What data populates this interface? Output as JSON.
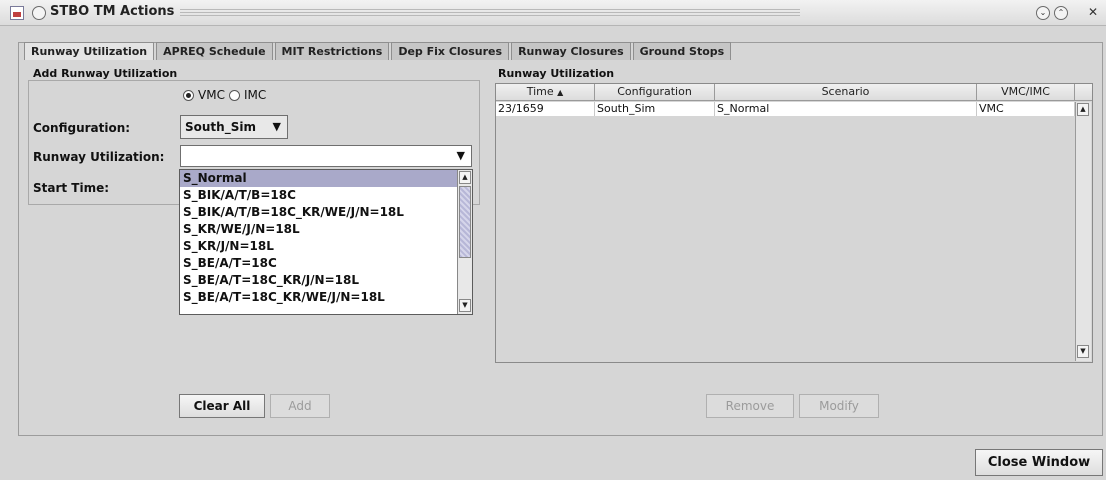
{
  "window": {
    "title": "STBO TM Actions",
    "minimize_icon": "chevron-down-circle-icon",
    "maximize_icon": "chevron-up-circle-icon",
    "close_icon": "close-circle-icon"
  },
  "tabs": [
    {
      "label": "Runway Utilization",
      "active": true
    },
    {
      "label": "APREQ Schedule",
      "active": false
    },
    {
      "label": "MIT Restrictions",
      "active": false
    },
    {
      "label": "Dep Fix Closures",
      "active": false
    },
    {
      "label": "Runway Closures",
      "active": false
    },
    {
      "label": "Ground Stops",
      "active": false
    }
  ],
  "add_panel": {
    "title": "Add Runway Utilization",
    "radio_vmc": "VMC",
    "radio_imc": "IMC",
    "selected_condition": "VMC",
    "configuration_label": "Configuration:",
    "configuration_value": "South_Sim",
    "runway_utilization_label": "Runway Utilization:",
    "runway_utilization_value": "",
    "start_time_label": "Start Time:",
    "dropdown_options": [
      "S_Normal",
      "S_BIK/A/T/B=18C",
      "S_BIK/A/T/B=18C_KR/WE/J/N=18L",
      "S_KR/WE/J/N=18L",
      "S_KR/J/N=18L",
      "S_BE/A/T=18C",
      "S_BE/A/T=18C_KR/J/N=18L",
      "S_BE/A/T=18C_KR/WE/J/N=18L"
    ],
    "dropdown_selected": "S_Normal"
  },
  "table_panel": {
    "title": "Runway Utilization",
    "columns": [
      "Time",
      "Configuration",
      "Scenario",
      "VMC/IMC"
    ],
    "sort_indicator": "▲",
    "rows": [
      [
        "23/1659",
        "South_Sim",
        "S_Normal",
        "VMC"
      ]
    ]
  },
  "buttons": {
    "clear_all": "Clear All",
    "add": "Add",
    "remove": "Remove",
    "modify": "Modify",
    "close_window": "Close Window"
  }
}
